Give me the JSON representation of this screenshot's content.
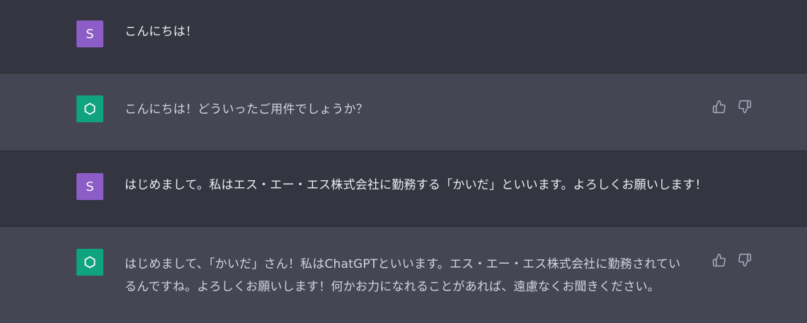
{
  "messages": [
    {
      "role": "user",
      "avatar_letter": "S",
      "text": "こんにちは！"
    },
    {
      "role": "assistant",
      "text": "こんにちは！どういったご用件でしょうか？"
    },
    {
      "role": "user",
      "avatar_letter": "S",
      "text": "はじめまして。私はエス・エー・エス株式会社に勤務する「かいだ」といいます。よろしくお願いします！"
    },
    {
      "role": "assistant",
      "text": "はじめまして、「かいだ」さん！私はChatGPTといいます。エス・エー・エス株式会社に勤務されているんですね。よろしくお願いします！何かお力になれることがあれば、遠慮なくお聞きください。"
    }
  ],
  "colors": {
    "user_bg": "#343541",
    "assistant_bg": "#444654",
    "user_avatar": "#8c5cc7",
    "assistant_avatar": "#10a37f"
  },
  "icons": {
    "assistant_avatar": "openai-logo-icon",
    "like": "thumbs-up-icon",
    "dislike": "thumbs-down-icon"
  }
}
